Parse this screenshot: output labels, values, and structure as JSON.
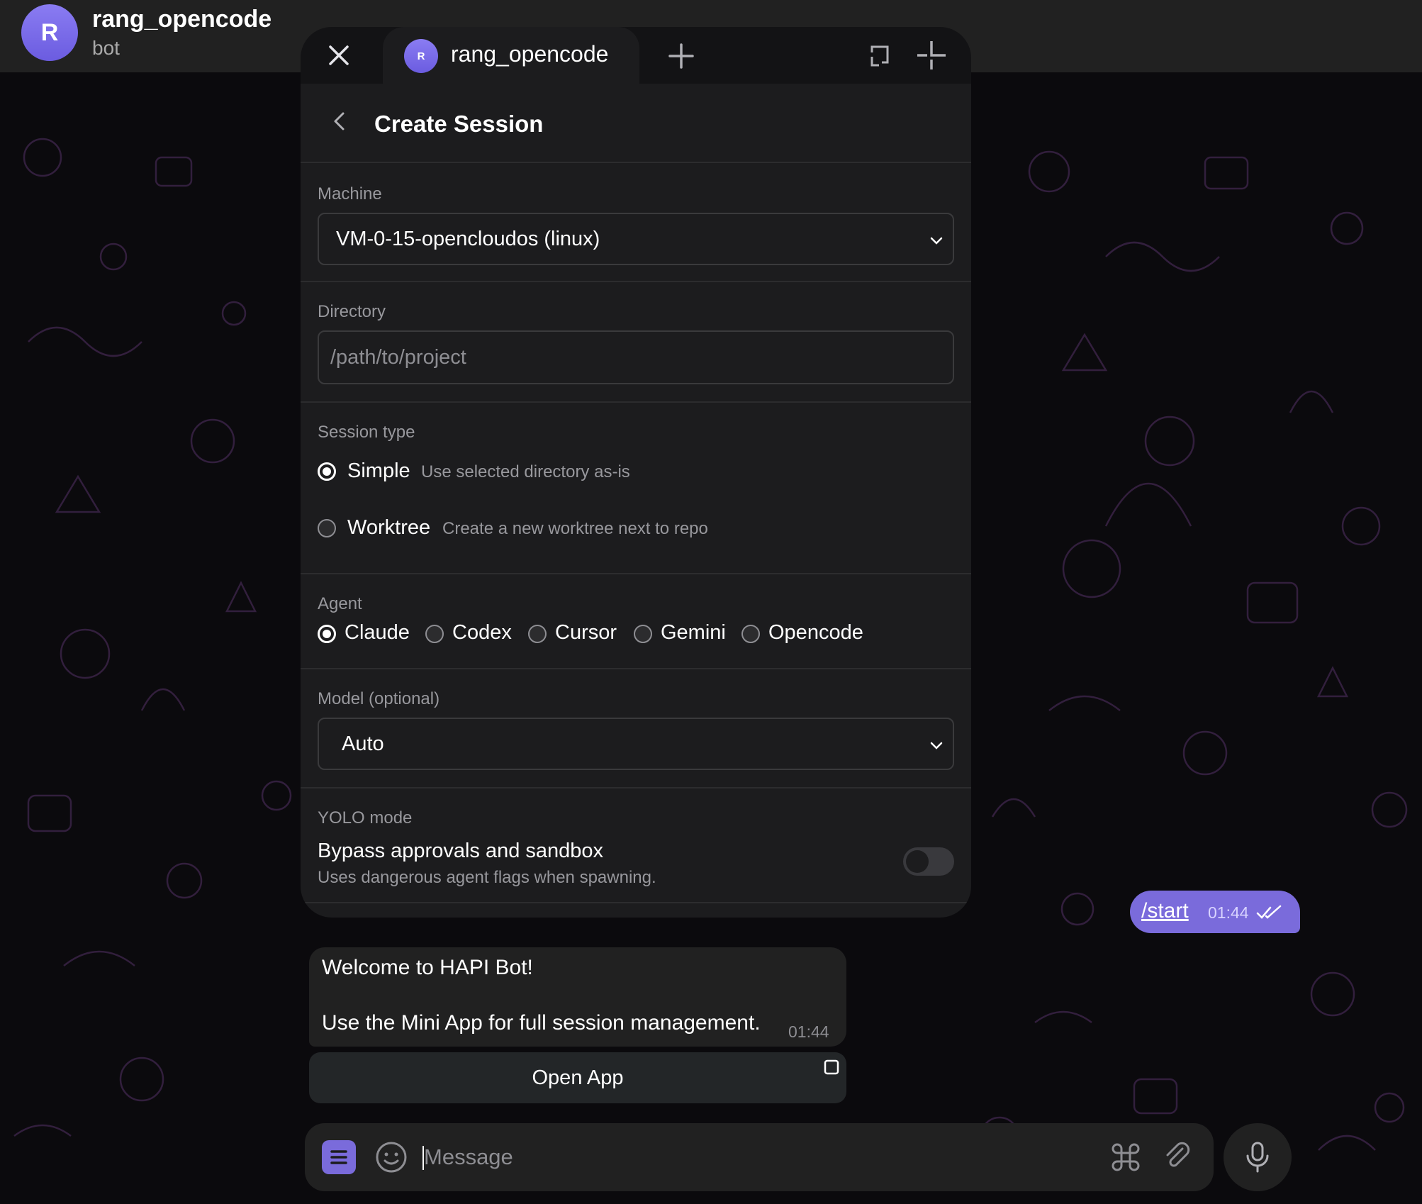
{
  "header": {
    "avatar_letter": "R",
    "title": "rang_opencode",
    "subtitle": "bot"
  },
  "miniapp": {
    "tab_title": "rang_opencode",
    "tab_avatar_letter": "R",
    "page_title": "Create Session",
    "machine": {
      "label": "Machine",
      "value": "VM-0-15-opencloudos (linux)"
    },
    "directory": {
      "label": "Directory",
      "value": "",
      "placeholder": "/path/to/project"
    },
    "session_type": {
      "label": "Session type",
      "options": [
        {
          "name": "Simple",
          "desc": "Use selected directory as-is",
          "checked": true
        },
        {
          "name": "Worktree",
          "desc": "Create a new worktree next to repo",
          "checked": false
        }
      ]
    },
    "agent": {
      "label": "Agent",
      "options": [
        "Claude",
        "Codex",
        "Cursor",
        "Gemini",
        "Opencode"
      ],
      "selected": "Claude"
    },
    "model": {
      "label": "Model (optional)",
      "value": "Auto"
    },
    "yolo": {
      "label": "YOLO mode",
      "title": "Bypass approvals and sandbox",
      "desc": "Uses dangerous agent flags when spawning.",
      "enabled": false
    }
  },
  "messages": {
    "outgoing": {
      "text": "/start",
      "time": "01:44"
    },
    "incoming": {
      "line1": "Welcome to HAPI Bot!",
      "line2": "Use the Mini App for full session management.",
      "time": "01:44"
    },
    "open_app_label": "Open App"
  },
  "composer": {
    "placeholder": "Message"
  },
  "colors": {
    "accent": "#7a6bdb",
    "background": "#0b0a0d",
    "panel": "#1c1c1e",
    "header": "#212121"
  }
}
